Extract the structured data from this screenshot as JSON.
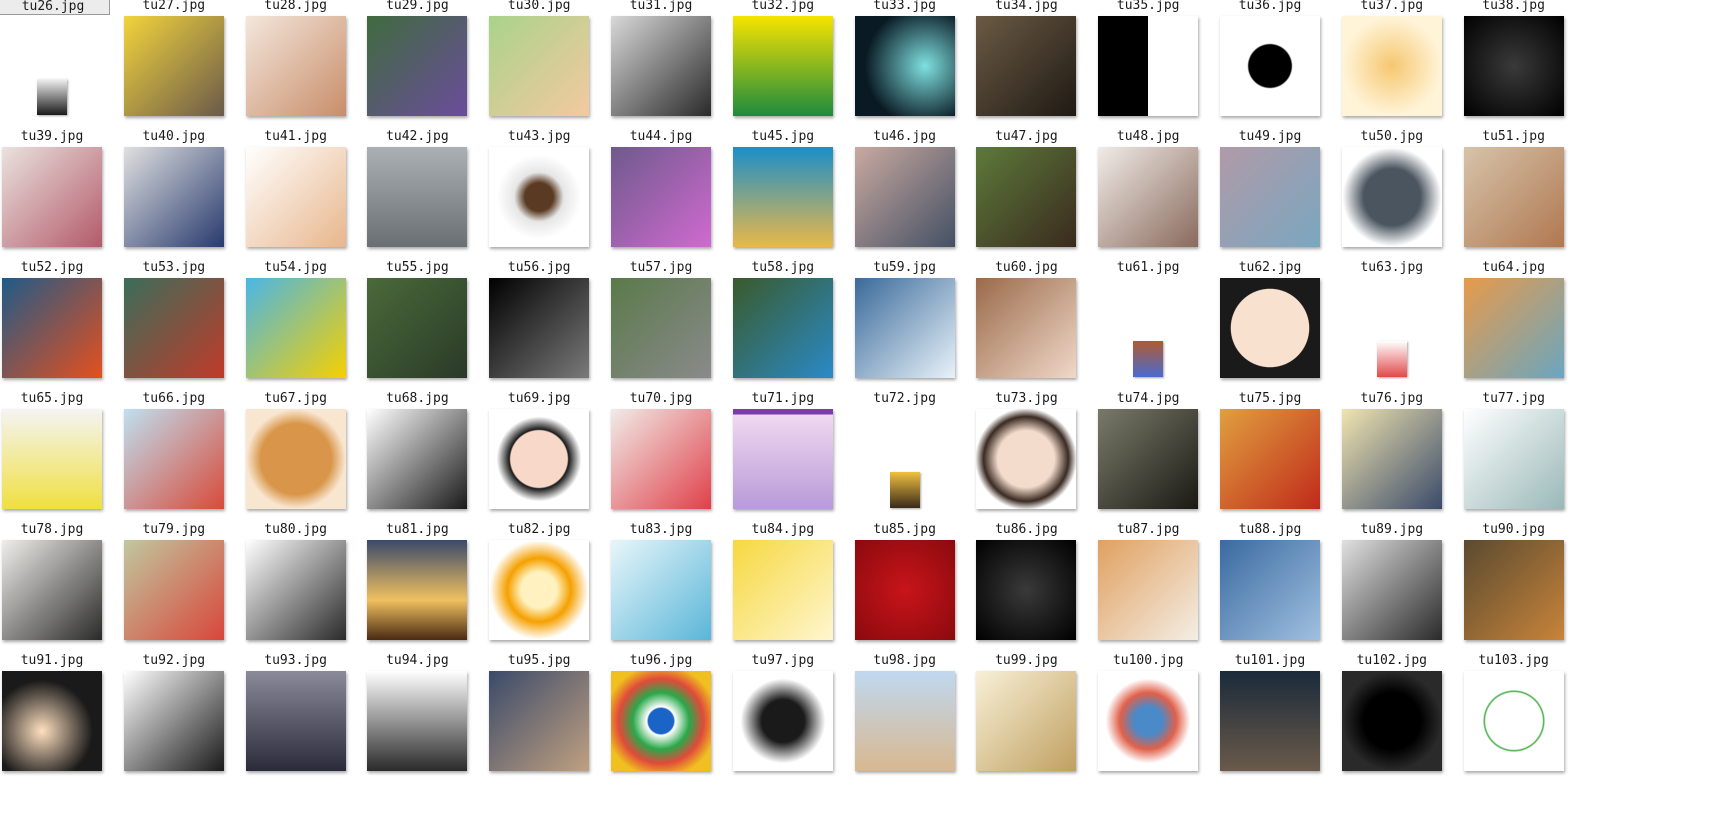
{
  "items": [
    {
      "label": "tu26.jpg",
      "bg": "#ffffff",
      "selected": true
    },
    {
      "label": "tu27.jpg",
      "bg": "#ffffff"
    },
    {
      "label": "tu28.jpg",
      "bg": "#ffffff"
    },
    {
      "label": "tu29.jpg",
      "bg": "#ffffff"
    },
    {
      "label": "tu30.jpg",
      "bg": "#ffffff"
    },
    {
      "label": "tu31.jpg",
      "bg": "#ffffff"
    },
    {
      "label": "tu32.jpg",
      "bg": "#ffffff"
    },
    {
      "label": "tu33.jpg",
      "bg": "#ffffff"
    },
    {
      "label": "tu34.jpg",
      "bg": "#ffffff"
    },
    {
      "label": "tu35.jpg",
      "bg": "#ffffff"
    },
    {
      "label": "tu36.jpg",
      "bg": "#ffffff"
    },
    {
      "label": "tu37.jpg",
      "bg": "#ffffff"
    },
    {
      "label": "tu38.jpg",
      "bg": "#ffffff"
    },
    {
      "label": "tu39.jpg",
      "bg": "linear-gradient(#f2f2f2,#1a1a1a)",
      "variant": "small"
    },
    {
      "label": "tu40.jpg",
      "bg": "linear-gradient(135deg,#f2d43c,#6b5a4a)"
    },
    {
      "label": "tu41.jpg",
      "bg": "linear-gradient(135deg,#f3e7dc,#c98d6a)"
    },
    {
      "label": "tu42.jpg",
      "bg": "linear-gradient(135deg,#3f6b3e,#6b4c9c)"
    },
    {
      "label": "tu43.jpg",
      "bg": "linear-gradient(135deg,#a9d38a,#f4c9a0)"
    },
    {
      "label": "tu44.jpg",
      "bg": "linear-gradient(135deg,#d9d9d9,#2a2a2a)"
    },
    {
      "label": "tu45.jpg",
      "bg": "linear-gradient(#f6e400,#1e8a3e)"
    },
    {
      "label": "tu46.jpg",
      "bg": "radial-gradient(circle at 70% 50%,#7fe0e0,#0a1a24 70%)"
    },
    {
      "label": "tu47.jpg",
      "bg": "linear-gradient(135deg,#6b5a44,#1f1a14)"
    },
    {
      "label": "tu48.jpg",
      "bg": "linear-gradient(90deg,#000000 50%,#ffffff 50%)"
    },
    {
      "label": "tu49.jpg",
      "bg": "radial-gradient(circle,#000000 30%,#ffffff 32%)"
    },
    {
      "label": "tu50.jpg",
      "bg": "radial-gradient(circle,#f6c770,#fff4d8 70%)"
    },
    {
      "label": "tu51.jpg",
      "bg": "radial-gradient(circle,#3a3a3a,#000000)"
    },
    {
      "label": "tu52.jpg",
      "bg": "linear-gradient(135deg,#e9e2de,#b45a6a)"
    },
    {
      "label": "tu53.jpg",
      "bg": "linear-gradient(135deg,#e0e0e0,#283a6e)"
    },
    {
      "label": "tu54.jpg",
      "bg": "linear-gradient(135deg,#ffffff,#e8b68c)"
    },
    {
      "label": "tu55.jpg",
      "bg": "linear-gradient(#aab0b4,#6a6f73)"
    },
    {
      "label": "tu56.jpg",
      "bg": "radial-gradient(circle,#5a3a22 20%,#e6e6e6 35%,#ffffff 60%)"
    },
    {
      "label": "tu57.jpg",
      "bg": "linear-gradient(135deg,#6e5a8c,#d06ad0)"
    },
    {
      "label": "tu58.jpg",
      "bg": "linear-gradient(#1b8ec9,#e9b84a)"
    },
    {
      "label": "tu59.jpg",
      "bg": "linear-gradient(135deg,#c9a9a0,#445064)"
    },
    {
      "label": "tu60.jpg",
      "bg": "linear-gradient(135deg,#5d7a3a,#3a2a1e)"
    },
    {
      "label": "tu61.jpg",
      "bg": "linear-gradient(135deg,#f0ece8,#8a6a5c)"
    },
    {
      "label": "tu62.jpg",
      "bg": "linear-gradient(135deg,#b09aa8,#7aa7c0)"
    },
    {
      "label": "tu63.jpg",
      "bg": "radial-gradient(circle,#4a5560 40%,#ffffff 70%)"
    },
    {
      "label": "tu64.jpg",
      "bg": "linear-gradient(135deg,#d6c3aa,#b07850)"
    },
    {
      "label": "tu65.jpg",
      "bg": "linear-gradient(135deg,#1f5a88,#e5501e)"
    },
    {
      "label": "tu66.jpg",
      "bg": "linear-gradient(135deg,#3a6e5a,#c03a2a)"
    },
    {
      "label": "tu67.jpg",
      "bg": "linear-gradient(135deg,#4ab6e6,#f6d000)"
    },
    {
      "label": "tu68.jpg",
      "bg": "linear-gradient(135deg,#4a6a3a,#2a3a28)"
    },
    {
      "label": "tu69.jpg",
      "bg": "linear-gradient(135deg,#000000,#7a7a7a)"
    },
    {
      "label": "tu70.jpg",
      "bg": "linear-gradient(135deg,#5a7a4a,#8a8a8a)"
    },
    {
      "label": "tu71.jpg",
      "bg": "linear-gradient(135deg,#3a5a2a,#2a8ac8)"
    },
    {
      "label": "tu72.jpg",
      "bg": "linear-gradient(135deg,#3a6a9a,#e8f2fa)"
    },
    {
      "label": "tu73.jpg",
      "bg": "linear-gradient(135deg,#9a6a4a,#f0d8c8)"
    },
    {
      "label": "tu74.jpg",
      "bg": "linear-gradient(#b05a30,#4a6ad0)",
      "variant": "small"
    },
    {
      "label": "tu75.jpg",
      "bg": "radial-gradient(circle,#f9e1d0 55%,#1a1a1a 56%)"
    },
    {
      "label": "tu76.jpg",
      "bg": "linear-gradient(#ffffff,#e04a4a)",
      "variant": "small"
    },
    {
      "label": "tu77.jpg",
      "bg": "linear-gradient(135deg,#e89a4a,#6aa6c0)"
    },
    {
      "label": "tu78.jpg",
      "bg": "linear-gradient(#f4f4f4,#f0e040)"
    },
    {
      "label": "tu79.jpg",
      "bg": "linear-gradient(135deg,#bfe0f0,#d84a3a)"
    },
    {
      "label": "tu80.jpg",
      "bg": "radial-gradient(circle,#d9964a 50%,#f8e6d0 70%)"
    },
    {
      "label": "tu81.jpg",
      "bg": "linear-gradient(135deg,#ffffff,#1a1a1a)"
    },
    {
      "label": "tu82.jpg",
      "bg": "radial-gradient(circle,#f8d8c8 40%,#1a1a1a 42%,#ffffff 60%)"
    },
    {
      "label": "tu83.jpg",
      "bg": "linear-gradient(135deg,#f0ece8,#e0404a)"
    },
    {
      "label": "tu84.jpg",
      "bg": "linear-gradient(#7a3ab0 5%,#f0d8f0 6%,#b89ad8)"
    },
    {
      "label": "tu85.jpg",
      "bg": "linear-gradient(#f0c040,#3a2a1a)",
      "variant": "small"
    },
    {
      "label": "tu86.jpg",
      "bg": "radial-gradient(circle,#f4dccc 40%,#3a2a22 60%,#ffffff 72%)"
    },
    {
      "label": "tu87.jpg",
      "bg": "linear-gradient(135deg,#7a7a6a,#1a1a14)"
    },
    {
      "label": "tu88.jpg",
      "bg": "linear-gradient(135deg,#e0a040,#c02a1a)"
    },
    {
      "label": "tu89.jpg",
      "bg": "linear-gradient(135deg,#f0e4b0,#3a4a6a)"
    },
    {
      "label": "tu90.jpg",
      "bg": "linear-gradient(135deg,#ffffff,#9ab8b8)"
    },
    {
      "label": "tu91.jpg",
      "bg": "linear-gradient(135deg,#f0eeea,#2a2a2a)"
    },
    {
      "label": "tu92.jpg",
      "bg": "linear-gradient(135deg,#c0c8a0,#d8463a)"
    },
    {
      "label": "tu93.jpg",
      "bg": "linear-gradient(135deg,#ffffff,#2a2a2a)"
    },
    {
      "label": "tu94.jpg",
      "bg": "linear-gradient(#3a4a6a,#f0c060 60%,#4a2a12)"
    },
    {
      "label": "tu95.jpg",
      "bg": "radial-gradient(circle,#fff2c0 25%,#f5a000 45%,#ffffff 70%)"
    },
    {
      "label": "tu96.jpg",
      "bg": "linear-gradient(135deg,#e8f6fa,#5ab6d8)"
    },
    {
      "label": "tu97.jpg",
      "bg": "linear-gradient(135deg,#f6d840,#fff6d0)"
    },
    {
      "label": "tu98.jpg",
      "bg": "radial-gradient(circle,#c8141a,#8a0a0e)"
    },
    {
      "label": "tu99.jpg",
      "bg": "radial-gradient(circle,#3a3a3a,#000000)"
    },
    {
      "label": "tu100.jpg",
      "bg": "linear-gradient(135deg,#e0a060,#f4eee4)"
    },
    {
      "label": "tu101.jpg",
      "bg": "linear-gradient(135deg,#3a6aa0,#a0c0e0)"
    },
    {
      "label": "tu102.jpg",
      "bg": "linear-gradient(135deg,#e0e0e0,#2a2a2a)"
    },
    {
      "label": "tu103.jpg",
      "bg": "linear-gradient(135deg,#5a4a30,#c8843a)"
    },
    {
      "label": "",
      "bg": "radial-gradient(circle at 40% 60%,#ffe0c0,#1a1a1a 60%)"
    },
    {
      "label": "",
      "bg": "linear-gradient(135deg,#ffffff,#1a1a1a)"
    },
    {
      "label": "",
      "bg": "linear-gradient(#8a8a9a,#2a2a3a)"
    },
    {
      "label": "",
      "bg": "linear-gradient(#ffffff,#2a2a2a)"
    },
    {
      "label": "",
      "bg": "linear-gradient(135deg,#3a4a6a,#c0a080)"
    },
    {
      "label": "",
      "bg": "radial-gradient(circle,#1a64c8 18%,#ffffff 20%,#2aa84a 40%,#e04a3a 60%,#f0c020 80%)"
    },
    {
      "label": "",
      "bg": "radial-gradient(circle,#1a1a1a 30%,#ffffff 60%)"
    },
    {
      "label": "",
      "bg": "linear-gradient(#c0d8f0,#d8b890)"
    },
    {
      "label": "",
      "bg": "linear-gradient(135deg,#f8f0d8,#c0a060)"
    },
    {
      "label": "",
      "bg": "radial-gradient(circle,#4a8ac8 20%,#e0604a 40%,#ffffff 60%)"
    },
    {
      "label": "",
      "bg": "linear-gradient(#1a2a3a,#6a5a4a)"
    },
    {
      "label": "",
      "bg": "radial-gradient(circle,#000000 40%,#2a2a2a 70%)"
    },
    {
      "label": "",
      "bg": "radial-gradient(circle,#ffffff 40%,#3aa83a 42%,#ffffff 44%)"
    }
  ]
}
